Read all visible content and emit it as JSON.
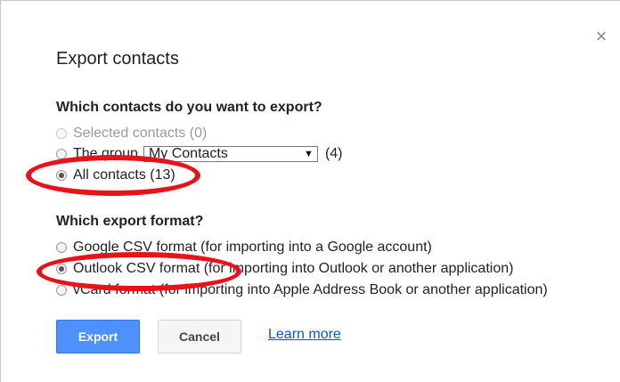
{
  "dialog": {
    "title": "Export contacts",
    "close_icon": "close-icon",
    "close_glyph": "×"
  },
  "contacts_section": {
    "heading": "Which contacts do you want to export?",
    "options": [
      {
        "label": "Selected contacts (0)",
        "selected": false,
        "disabled": true
      },
      {
        "label": "The group",
        "selected": false,
        "disabled": false
      },
      {
        "label": "All contacts (13)",
        "selected": true,
        "disabled": false
      }
    ],
    "group_select": {
      "value": "My Contacts",
      "count": "(4)"
    }
  },
  "format_section": {
    "heading": "Which export format?",
    "options": [
      {
        "label": "Google CSV format (for importing into a Google account)",
        "selected": false
      },
      {
        "label": "Outlook CSV format (for importing into Outlook or another application)",
        "selected": true
      },
      {
        "label": "vCard format (for importing into Apple Address Book or another application)",
        "selected": false
      }
    ]
  },
  "actions": {
    "export_label": "Export",
    "cancel_label": "Cancel",
    "learn_more_label": "Learn more"
  },
  "colors": {
    "primary": "#4d90fe",
    "link": "#1155cc",
    "annotation": "#e8121b"
  }
}
